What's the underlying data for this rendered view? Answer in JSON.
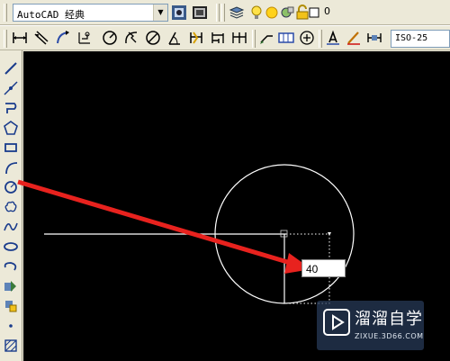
{
  "toolbar": {
    "workspace": "AutoCAD 经典",
    "layer_value": "0",
    "dim_style": "ISO-25"
  },
  "drawing": {
    "dynamic_input_value": "40"
  },
  "watermark": {
    "title": "溜溜自学",
    "url": "ZIXUE.3D66.COM"
  },
  "colors": {
    "canvas": "#000000",
    "annotation_arrow": "#e8221e",
    "toolbar": "#ece9d8"
  },
  "icons": {
    "top_row_1": [
      "workspace-settings-icon",
      "workspace-toolbar-icon",
      "layer-manager-icon",
      "layer-on-bulb-icon",
      "layer-freeze-sun-icon",
      "layer-viewport-icon",
      "layer-lock-icon",
      "layer-color-square-icon"
    ],
    "top_row_2": [
      "linear-dim-icon",
      "aligned-dim-icon",
      "arc-length-dim-icon",
      "ordinate-dim-icon",
      "radius-dim-icon",
      "jogged-dim-icon",
      "diameter-dim-icon",
      "angular-dim-icon",
      "quick-dim-icon",
      "baseline-dim-icon",
      "continue-dim-icon",
      "quick-leader-icon",
      "tolerance-icon",
      "center-mark-icon",
      "dim-edit-icon",
      "dim-text-edit-icon",
      "dim-update-icon"
    ],
    "left": [
      "line-icon",
      "construction-line-icon",
      "polyline-icon",
      "polygon-icon",
      "rectangle-icon",
      "arc-icon",
      "circle-icon",
      "revision-cloud-icon",
      "spline-icon",
      "ellipse-icon",
      "ellipse-arc-icon",
      "insert-block-icon",
      "make-block-icon",
      "point-icon",
      "hatch-icon"
    ]
  }
}
